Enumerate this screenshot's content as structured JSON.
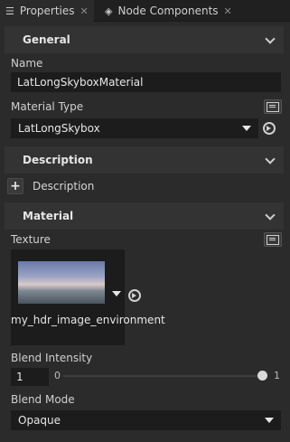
{
  "tabs": [
    {
      "label": "Properties",
      "icon": "list-icon",
      "active": true
    },
    {
      "label": "Node Components",
      "icon": "components-icon",
      "active": false
    }
  ],
  "sections": {
    "general": "General",
    "description": "Description",
    "material": "Material"
  },
  "general": {
    "name_label": "Name",
    "name_value": "LatLongSkyboxMaterial",
    "material_type_label": "Material Type",
    "material_type_value": "LatLongSkybox"
  },
  "description": {
    "add_label": "+",
    "item_label": "Description"
  },
  "material": {
    "texture_label": "Texture",
    "texture_name": "my_hdr_image_environment",
    "blend_intensity_label": "Blend Intensity",
    "blend_intensity_value": "1",
    "slider_min": "0",
    "slider_max": "1",
    "slider_fraction": 1.0,
    "blend_mode_label": "Blend Mode",
    "blend_mode_value": "Opaque"
  },
  "colors": {
    "accent": "#e6e6e6",
    "background": "#2b2b2b",
    "field": "#1c1c1c"
  }
}
